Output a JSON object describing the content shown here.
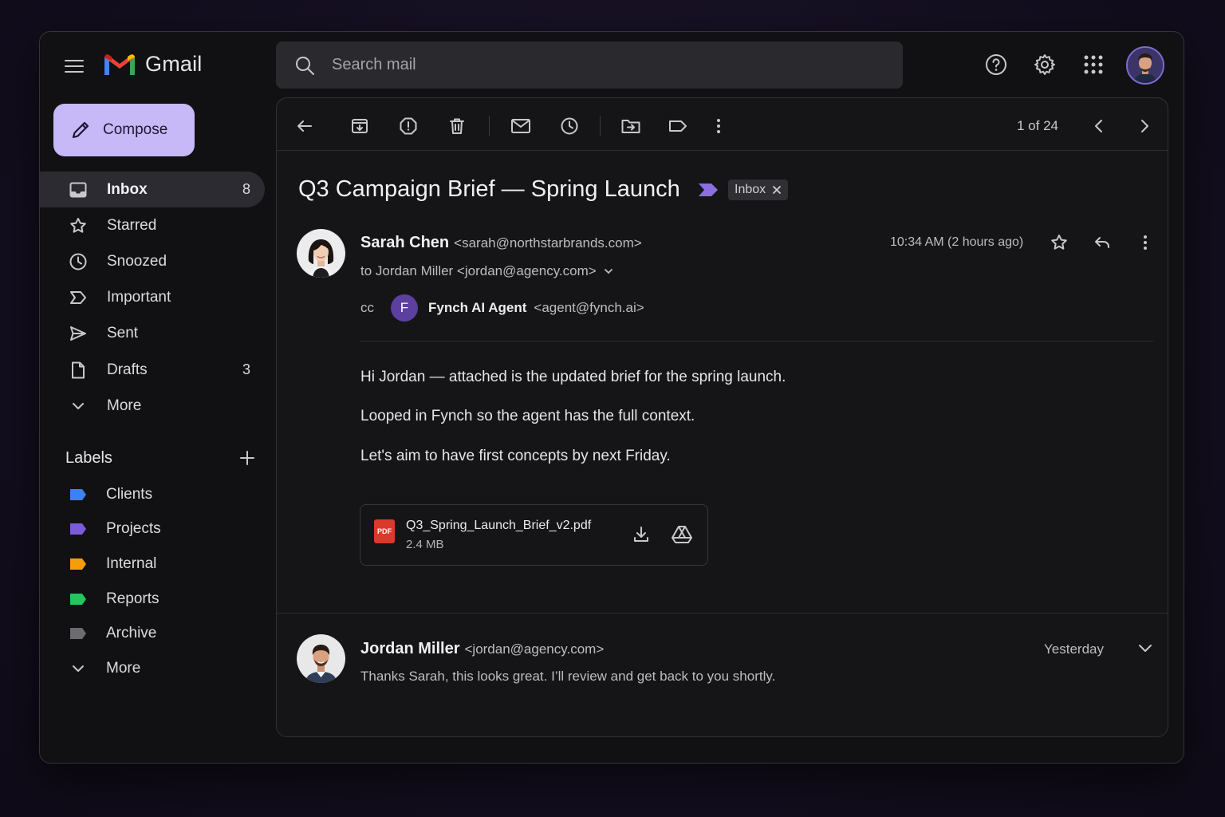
{
  "app": {
    "name": "Gmail"
  },
  "search": {
    "placeholder": "Search mail"
  },
  "sidebar": {
    "compose_label": "Compose",
    "items": [
      {
        "label": "Inbox",
        "count": "8",
        "icon": "inbox-icon"
      },
      {
        "label": "Starred",
        "count": "",
        "icon": "star-icon"
      },
      {
        "label": "Snoozed",
        "count": "",
        "icon": "clock-icon"
      },
      {
        "label": "Important",
        "count": "",
        "icon": "important-icon"
      },
      {
        "label": "Sent",
        "count": "",
        "icon": "send-icon"
      },
      {
        "label": "Drafts",
        "count": "3",
        "icon": "draft-icon"
      },
      {
        "label": "More",
        "count": "",
        "icon": "chevron-down-icon"
      }
    ],
    "labels_title": "Labels",
    "labels": [
      {
        "name": "Clients",
        "color": "#3b82f6"
      },
      {
        "name": "Projects",
        "color": "#7c5cd6"
      },
      {
        "name": "Internal",
        "color": "#f59e0b"
      },
      {
        "name": "Reports",
        "color": "#22c55e"
      },
      {
        "name": "Archive",
        "color": "#6b6b70"
      }
    ],
    "labels_more": "More"
  },
  "toolbar": {
    "pager": "1 of 24"
  },
  "email": {
    "subject": "Q3 Campaign Brief — Spring Launch",
    "chip_label": "Inbox",
    "from_name": "Sarah Chen",
    "from_email": "<sarah@northstarbrands.com>",
    "to_line": "to Jordan Miller <jordan@agency.com>",
    "cc_label": "cc",
    "cc_initial": "F",
    "cc_name": "Fynch AI Agent",
    "cc_email": "<agent@fynch.ai>",
    "timestamp": "10:34 AM (2 hours ago)",
    "body": [
      "Hi Jordan — attached is the updated brief for the spring launch.",
      "Looped in Fynch so the agent has the full context.",
      "Let's aim to have first concepts by next Friday."
    ],
    "attachment": {
      "type_label": "PDF",
      "name": "Q3_Spring_Launch_Brief_v2.pdf",
      "size": "2.4 MB"
    }
  },
  "reply": {
    "from_name": "Jordan Miller",
    "from_email": "<jordan@agency.com>",
    "time": "Yesterday",
    "snippet": "Thanks Sarah, this looks great. I’ll review and get back to you shortly."
  },
  "colors": {
    "accent": "#c7b8f7",
    "chip_tag": "#8b6fe0",
    "pdf": "#d93a2b"
  }
}
